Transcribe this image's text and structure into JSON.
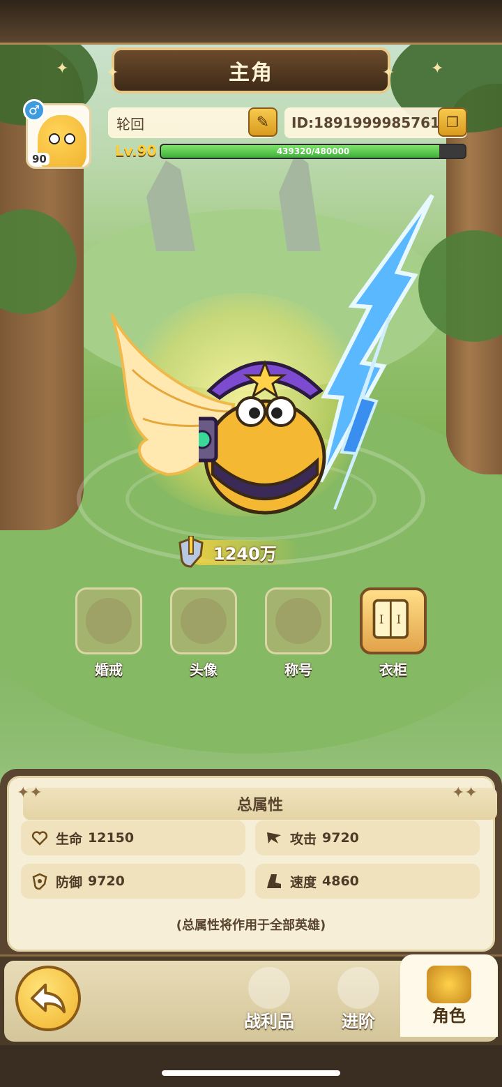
{
  "screen": {
    "title": "主角"
  },
  "player": {
    "level_badge": "90",
    "gender_symbol": "♂",
    "name": "轮回",
    "id_text": "ID:1891999985761",
    "level_text": "Lv.90",
    "xp_text": "439320/480000",
    "xp_fraction": 0.9153
  },
  "power": {
    "value": "1240万"
  },
  "slots": [
    {
      "label": "婚戒",
      "active": false
    },
    {
      "label": "头像",
      "active": false
    },
    {
      "label": "称号",
      "active": false
    },
    {
      "label": "衣柜",
      "active": true
    }
  ],
  "attributes": {
    "title": "总属性",
    "stats": [
      {
        "label": "生命",
        "value": "12150",
        "icon": "heart-icon"
      },
      {
        "label": "攻击",
        "value": "9720",
        "icon": "attack-icon"
      },
      {
        "label": "防御",
        "value": "9720",
        "icon": "shield-icon"
      },
      {
        "label": "速度",
        "value": "4860",
        "icon": "boot-icon"
      }
    ],
    "note": "(总属性将作用于全部英雄)"
  },
  "nav": {
    "tabs": [
      {
        "label": "战利品",
        "active": false
      },
      {
        "label": "进阶",
        "active": false
      },
      {
        "label": "角色",
        "active": true
      }
    ]
  },
  "colors": {
    "accent": "#f1b22c",
    "xp_fill": "#3fb03c",
    "panel_bg": "#f6eed6"
  }
}
